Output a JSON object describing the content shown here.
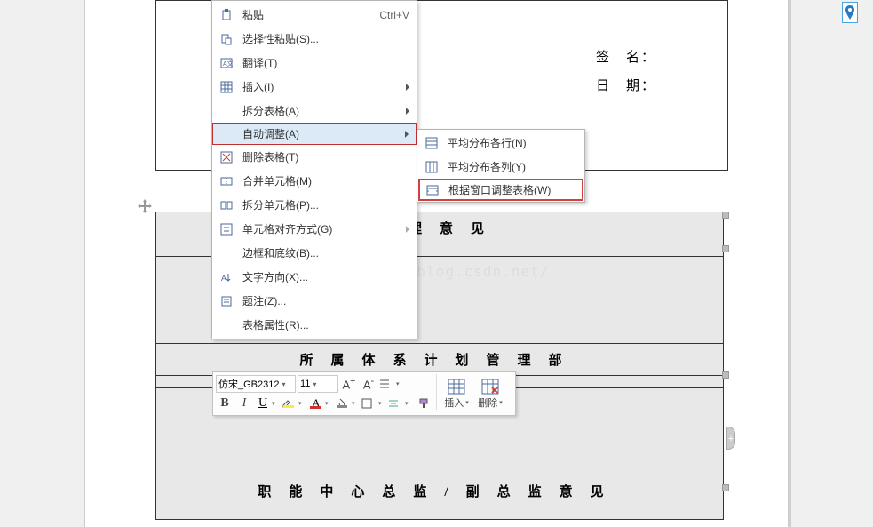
{
  "pin_badge_icon": "location-pin-icon",
  "doc_signature_label": "签　名：",
  "doc_date_label": "日　期：",
  "watermark": "http://blog.csdn.net/",
  "table": {
    "header1": "经理意见",
    "header2": "所属体系计划管理部",
    "header3": "职能中心总监/副总监意见"
  },
  "context_menu": {
    "items": [
      {
        "icon": "paste-icon",
        "label": "粘贴",
        "shortcut": "Ctrl+V",
        "arrow": false
      },
      {
        "icon": "paste-special-icon",
        "label": "选择性粘贴(S)...",
        "shortcut": "",
        "arrow": false
      },
      {
        "icon": "translate-icon",
        "label": "翻译(T)",
        "shortcut": "",
        "arrow": false
      },
      {
        "icon": "table-icon",
        "label": "插入(I)",
        "shortcut": "",
        "arrow": true
      },
      {
        "icon": "",
        "label": "拆分表格(A)",
        "shortcut": "",
        "arrow": true
      },
      {
        "icon": "",
        "label": "自动调整(A)",
        "shortcut": "",
        "arrow": true,
        "highlighted": true
      },
      {
        "icon": "delete-table-icon",
        "label": "删除表格(T)",
        "shortcut": "",
        "arrow": false
      },
      {
        "icon": "merge-cells-icon",
        "label": "合并单元格(M)",
        "shortcut": "",
        "arrow": false
      },
      {
        "icon": "split-cells-icon",
        "label": "拆分单元格(P)...",
        "shortcut": "",
        "arrow": false
      },
      {
        "icon": "align-icon",
        "label": "单元格对齐方式(G)",
        "shortcut": "",
        "arrow": true,
        "arrowGray": true
      },
      {
        "icon": "",
        "label": "边框和底纹(B)...",
        "shortcut": "",
        "arrow": false
      },
      {
        "icon": "text-direction-icon",
        "label": "文字方向(X)...",
        "shortcut": "",
        "arrow": false
      },
      {
        "icon": "caption-icon",
        "label": "题注(Z)...",
        "shortcut": "",
        "arrow": false
      },
      {
        "icon": "",
        "label": "表格属性(R)...",
        "shortcut": "",
        "arrow": false
      }
    ]
  },
  "submenu": {
    "items": [
      {
        "icon": "distribute-rows-icon",
        "label": "平均分布各行(N)"
      },
      {
        "icon": "distribute-cols-icon",
        "label": "平均分布各列(Y)"
      },
      {
        "icon": "fit-window-icon",
        "label": "根据窗口调整表格(W)",
        "highlighted": true
      }
    ]
  },
  "mini_toolbar": {
    "font": "仿宋_GB2312",
    "size": "11",
    "grow": "A⁺",
    "shrink": "A⁻",
    "bold": "B",
    "italic": "I",
    "underline": "U",
    "insert_label": "插入",
    "delete_label": "删除"
  },
  "expand_tab": "+"
}
